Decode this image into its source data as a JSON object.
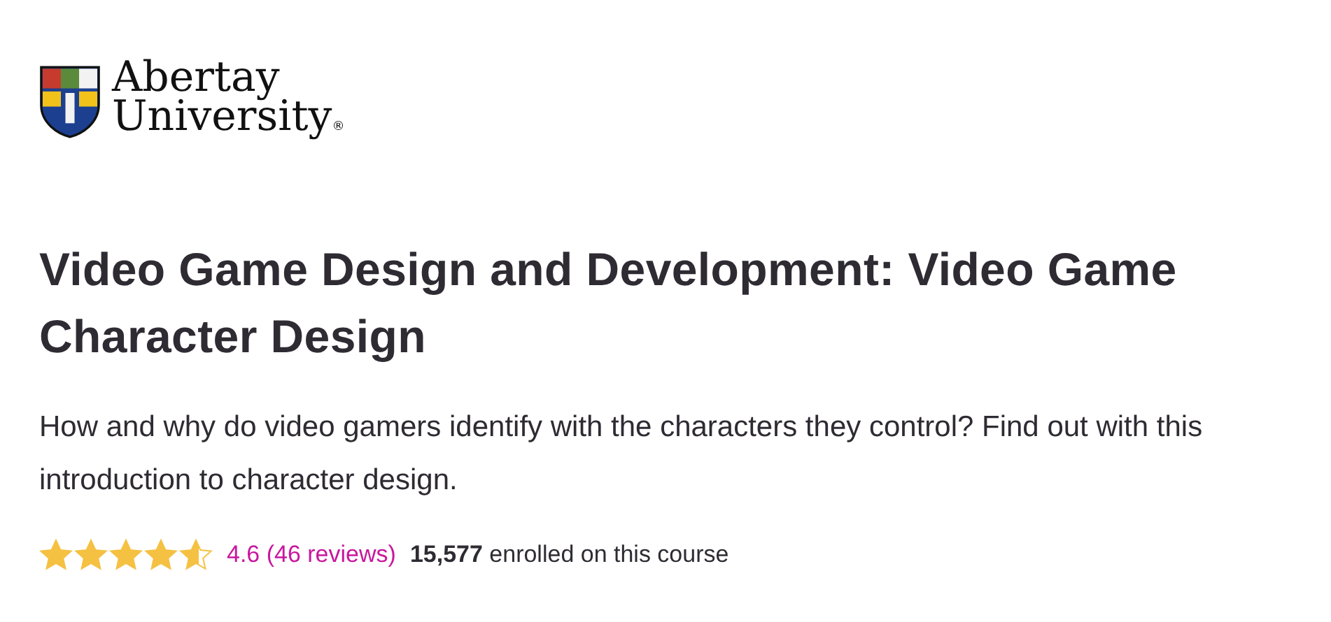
{
  "logo": {
    "line_1": "Abertay",
    "line_2": "University",
    "mark": "®"
  },
  "title": "Video Game Design and Development: Video Game Character Design",
  "description": "How and why do video gamers identify with the characters they control? Find out with this introduction to character design.",
  "rating": {
    "stars": 4.6,
    "reviews": "4.6 (46 reviews)",
    "enrolled": "**15,577** enrolled on this course"
  }
}
